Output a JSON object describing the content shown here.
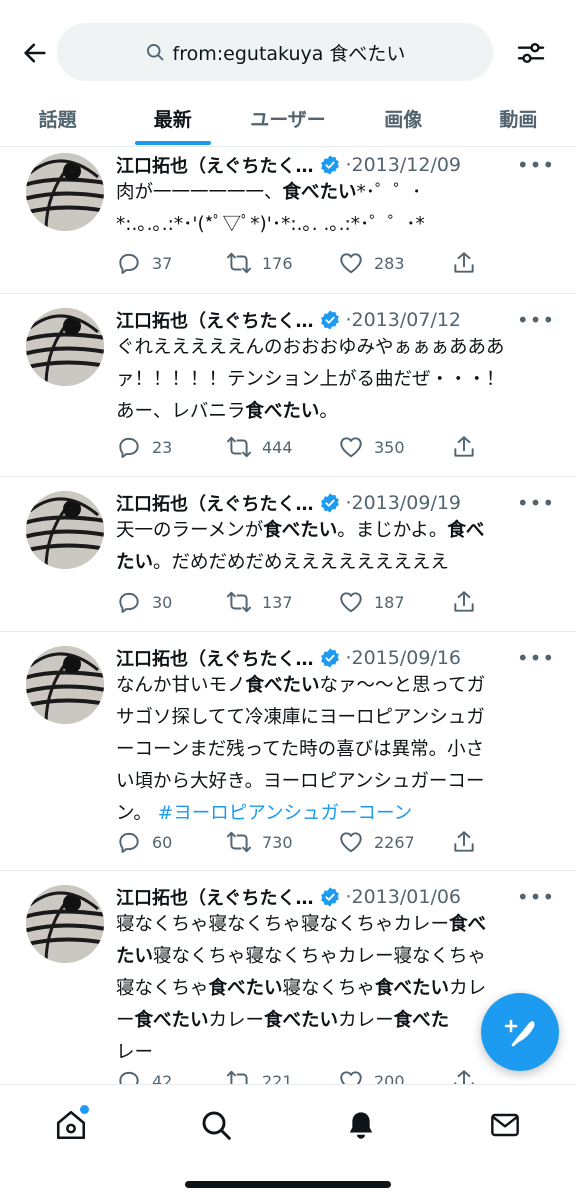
{
  "header": {
    "search_query": "from:egutakuya 食べたい",
    "tabs": [
      "話題",
      "最新",
      "ユーザー",
      "画像",
      "動画"
    ],
    "active_tab": 1
  },
  "colors": {
    "accent": "#1d9bf0",
    "text": "#0f1419",
    "muted": "#536471",
    "divider": "#e6ecf0"
  },
  "tweets": [
    {
      "name": "江口拓也（えぐちたく…",
      "date": "·2013/12/09",
      "lines": [
        [
          [
            "肉が一一一一一一、",
            false
          ],
          [
            "食べたい",
            true
          ],
          [
            "*･゜゜･",
            false
          ]
        ],
        [
          [
            "*:.｡.｡.:*･'(*ﾟ▽ﾟ*)'･*:.｡. .｡.:*･゜゜･*",
            false
          ]
        ]
      ],
      "replies": "37",
      "retweets": "176",
      "likes": "283"
    },
    {
      "name": "江口拓也（えぐちたく…",
      "date": "·2013/07/12",
      "lines": [
        [
          [
            "ぐれえええええんのおおおゆみやぁぁぁあああ",
            false
          ]
        ],
        [
          [
            "ァ！！！！！テンション上がる曲だぜ・・・！",
            false
          ]
        ],
        [
          [
            "あー、レバニラ",
            false
          ],
          [
            "食べたい",
            true
          ],
          [
            "。",
            false
          ]
        ]
      ],
      "replies": "23",
      "retweets": "444",
      "likes": "350"
    },
    {
      "name": "江口拓也（えぐちたく…",
      "date": "·2013/09/19",
      "lines": [
        [
          [
            "天一のラーメンが",
            false
          ],
          [
            "食べたい",
            true
          ],
          [
            "。まじかよ。",
            false
          ],
          [
            "食べ",
            true
          ]
        ],
        [
          [
            "たい",
            true
          ],
          [
            "。だめだめだめえええええええええ",
            false
          ]
        ]
      ],
      "replies": "30",
      "retweets": "137",
      "likes": "187"
    },
    {
      "name": "江口拓也（えぐちたく…",
      "date": "·2015/09/16",
      "lines": [
        [
          [
            "なんか甘いモノ",
            false
          ],
          [
            "食べたい",
            true
          ],
          [
            "なァ〜〜と思ってガ",
            false
          ]
        ],
        [
          [
            "サゴソ探してて冷凍庫にヨーロピアンシュガ",
            false
          ]
        ],
        [
          [
            "ーコーンまだ残ってた時の喜びは異常。小さ",
            false
          ]
        ],
        [
          [
            "い頃から大好き。ヨーロピアンシュガーコー",
            false
          ]
        ],
        [
          [
            "ン。 ",
            false
          ],
          [
            "#ヨーロピアンシュガーコーン",
            "tag"
          ]
        ]
      ],
      "replies": "60",
      "retweets": "730",
      "likes": "2267"
    },
    {
      "name": "江口拓也（えぐちたく…",
      "date": "·2013/01/06",
      "lines": [
        [
          [
            "寝なくちゃ寝なくちゃ寝なくちゃカレー",
            false
          ],
          [
            "食べ",
            true
          ]
        ],
        [
          [
            "たい",
            true
          ],
          [
            "寝なくちゃ寝なくちゃカレー寝なくちゃ",
            false
          ]
        ],
        [
          [
            "寝なくちゃ",
            false
          ],
          [
            "食べたい",
            true
          ],
          [
            "寝なくちゃ",
            false
          ],
          [
            "食べたい",
            true
          ],
          [
            "カレ",
            false
          ]
        ],
        [
          [
            "ー",
            false
          ],
          [
            "食べたい",
            true
          ],
          [
            "カレー",
            false
          ],
          [
            "食べたい",
            true
          ],
          [
            "カレー",
            false
          ],
          [
            "食べた",
            true
          ]
        ],
        [
          [
            "レー",
            false
          ]
        ]
      ],
      "replies": "42",
      "retweets": "221",
      "likes": "200"
    }
  ],
  "icons": {
    "back": "arrow-left-icon",
    "search": "magnifier-icon",
    "filter": "sliders-icon",
    "reply": "speech-bubble-icon",
    "retweet": "retweet-arrows-icon",
    "like": "heart-icon",
    "share": "share-upload-icon",
    "compose": "feather-plus-icon",
    "home": "house-icon",
    "explore": "magnifier-icon",
    "notifications": "bell-icon",
    "messages": "envelope-icon"
  }
}
